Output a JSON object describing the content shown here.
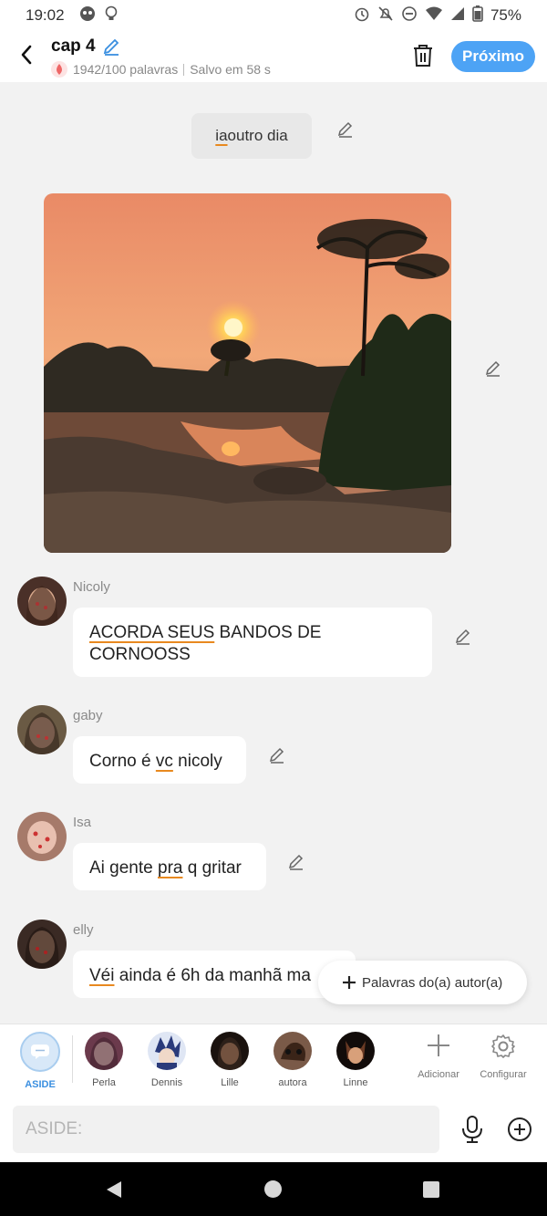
{
  "status_bar": {
    "time": "19:02",
    "battery": "75%"
  },
  "header": {
    "title": "cap 4",
    "word_count": "1942/100 palavras",
    "saved": "Salvo em 58 s",
    "next_label": "Próximo"
  },
  "chat": {
    "aside_text_underlined": "ia",
    "aside_text_rest": " outro dia",
    "messages": [
      {
        "author": "Nicoly",
        "parts": [
          {
            "t": "ACORDA SEUS",
            "u": true
          },
          {
            "t": " BANDOS DE CORNOOSS",
            "u": false
          }
        ]
      },
      {
        "author": "gaby",
        "parts": [
          {
            "t": "Corno é ",
            "u": false
          },
          {
            "t": "vc",
            "u": true
          },
          {
            "t": " nicoly",
            "u": false
          }
        ]
      },
      {
        "author": "Isa",
        "parts": [
          {
            "t": "Ai gente ",
            "u": false
          },
          {
            "t": "pra",
            "u": true
          },
          {
            "t": " q gritar",
            "u": false
          }
        ]
      },
      {
        "author": "elly",
        "parts": [
          {
            "t": "Véi",
            "u": true
          },
          {
            "t": " ainda é 6h da manhã ma",
            "u": false
          }
        ]
      }
    ]
  },
  "float_button": {
    "label": "Palavras do(a) autor(a)"
  },
  "characters": [
    {
      "name": "ASIDE",
      "active": true,
      "color": "#d8e8f8"
    },
    {
      "name": "Perla",
      "color": "#6b3a4c"
    },
    {
      "name": "Dennis",
      "color": "#3a4a8a"
    },
    {
      "name": "Lille",
      "color": "#3a2a22"
    },
    {
      "name": "autora",
      "color": "#5a3a2a"
    },
    {
      "name": "Linne",
      "color": "#2a1a14"
    }
  ],
  "tools": {
    "add": "Adicionar",
    "settings": "Configurar"
  },
  "input": {
    "placeholder": "ASIDE:"
  }
}
